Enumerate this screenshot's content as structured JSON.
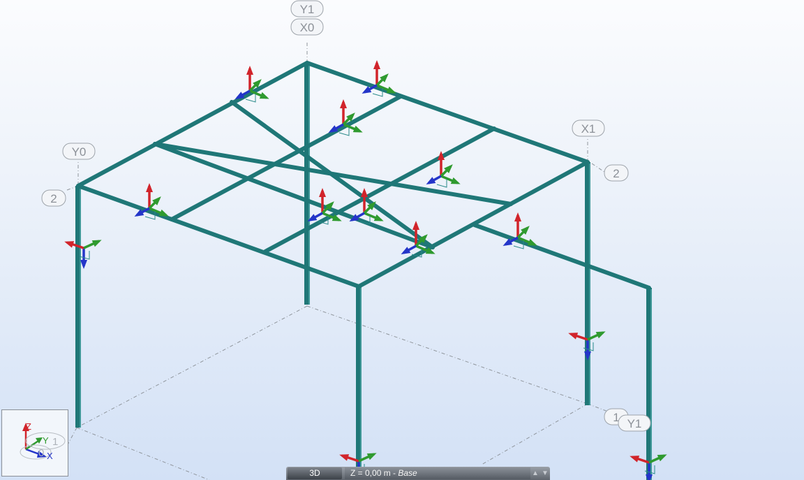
{
  "view": {
    "mode_label": "3D",
    "plane_value": "Z = 0,00 m",
    "plane_separator": " - ",
    "plane_level": "Base",
    "spin_up": "▲",
    "spin_down": "▼"
  },
  "axis_triad": {
    "z": "Z",
    "y": "Y",
    "x": "X",
    "hidden_label_1": "1",
    "hidden_label_0": "0"
  },
  "grid_labels": {
    "top_y1": "Y1",
    "top_x0": "X0",
    "right_x1": "X1",
    "right_2": "2",
    "left_y0": "Y0",
    "left_2": "2",
    "bottom_1": "1",
    "bottom_y1": "Y1"
  },
  "colors": {
    "member": "#1f7777",
    "axis_x": "#d1242b",
    "axis_y": "#2f9a2f",
    "axis_z": "#2435c9",
    "background_top": "#fbfcfe",
    "background_bottom": "#d3e1f6"
  }
}
